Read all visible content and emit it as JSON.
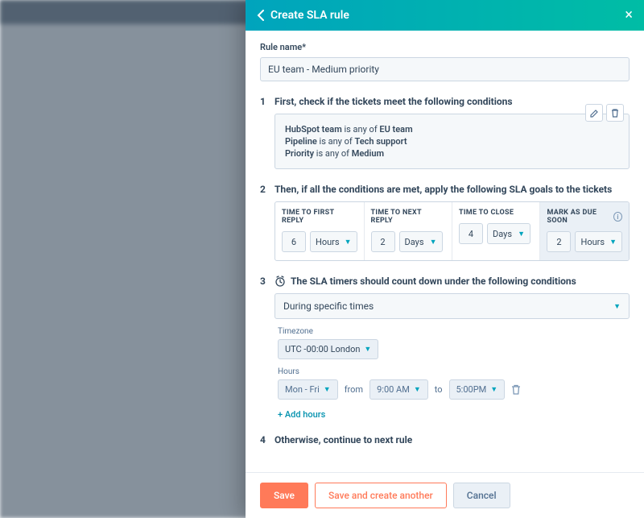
{
  "header": {
    "title": "Create SLA rule"
  },
  "ruleName": {
    "label": "Rule name*",
    "value": "EU team - Medium priority"
  },
  "section1": {
    "title": "First, check if the tickets meet the following conditions",
    "conds": [
      {
        "field": "HubSpot team",
        "op": "is any of",
        "value": "EU team"
      },
      {
        "field": "Pipeline",
        "op": "is any of",
        "value": "Tech support"
      },
      {
        "field": "Priority",
        "op": "is any of",
        "value": "Medium"
      }
    ]
  },
  "section2": {
    "title": "Then, if all the conditions are met, apply the following SLA goals to the tickets",
    "cols": [
      {
        "header": "TIME TO FIRST REPLY",
        "num": "6",
        "unit": "Hours",
        "info": false
      },
      {
        "header": "TIME TO NEXT REPLY",
        "num": "2",
        "unit": "Days",
        "info": false
      },
      {
        "header": "TIME TO CLOSE",
        "num": "4",
        "unit": "Days",
        "info": false
      },
      {
        "header": "MARK AS DUE SOON",
        "num": "2",
        "unit": "Hours",
        "info": true
      }
    ]
  },
  "section3": {
    "title": "The SLA timers should count down under the following conditions",
    "mode": "During specific times",
    "tzLabel": "Timezone",
    "tz": "UTC -00:00 London",
    "hoursLabel": "Hours",
    "days": "Mon - Fri",
    "fromLabel": "from",
    "from": "9:00 AM",
    "toLabel": "to",
    "to": "5:00PM",
    "addHours": "+ Add hours"
  },
  "section4": {
    "title": "Otherwise, continue to next rule"
  },
  "footer": {
    "save": "Save",
    "saveAnother": "Save and create another",
    "cancel": "Cancel"
  }
}
